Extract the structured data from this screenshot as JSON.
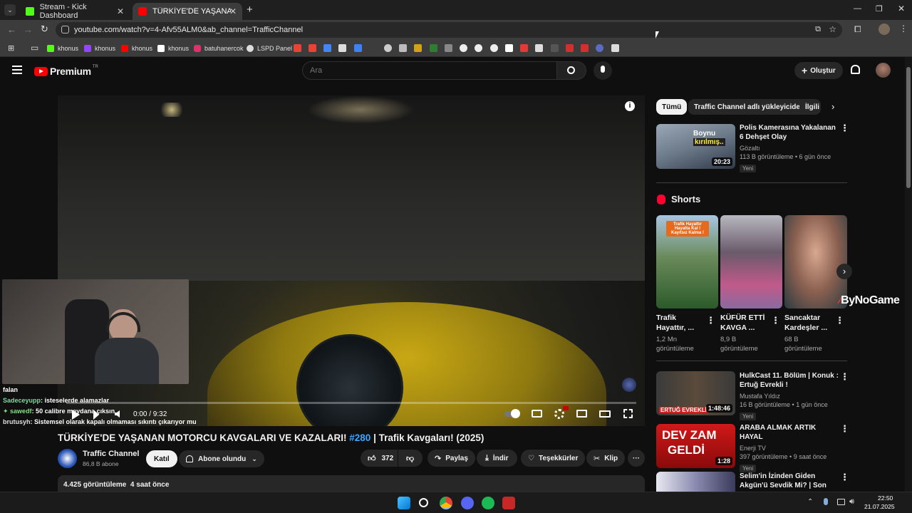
{
  "browser": {
    "tabs": [
      {
        "title": "Stream - Kick Dashboard",
        "color": "#53fc18"
      },
      {
        "title": "TÜRKİYE'DE YAŞANAN MOTORC",
        "color": "#ff0000"
      }
    ],
    "url": "youtube.com/watch?v=4-Afv55ALM0&ab_channel=TrafficChannel",
    "bookmarks": [
      {
        "label": "khonus",
        "color": "#53fc18"
      },
      {
        "label": "khonus",
        "color": "#9146ff"
      },
      {
        "label": "khonus",
        "color": "#ff0000"
      },
      {
        "label": "khonus",
        "color": "#ffffff"
      },
      {
        "label": "batuhanercok",
        "color": "#e1306c"
      },
      {
        "label": "LSPD Panel",
        "color": "#dddddd"
      }
    ]
  },
  "youtube": {
    "logo": "Premium",
    "logo_sup": "TR",
    "search_placeholder": "Ara",
    "create_label": "Oluştur",
    "video": {
      "title_pre": "TÜRKİYE'DE YAŞANAN MOTORCU KAVGALARI VE KAZALARI!",
      "hashtag": "#280",
      "title_post": "| Trafik Kavgaları! (2025)",
      "time": "0:00 / 9:32",
      "progress": 0,
      "views_line": "4.425 görüntüleme  4 saat önce"
    },
    "channel": {
      "name": "Traffic Channel",
      "subs": "86,8 B abone",
      "join": "Katıl",
      "subscribed": "Abone olundu"
    },
    "actions": {
      "likes": "372",
      "share": "Paylaş",
      "download": "İndir",
      "thanks": "Teşekkürler",
      "clip": "Klip"
    },
    "chips": [
      "Tümü",
      "Traffic Channel adlı yükleyiciden",
      "İlgili"
    ],
    "first_video": {
      "title": "Polis Kamerasına Yakalanan 6 Dehşet Olay",
      "channel": "Gözaltı",
      "meta": "113 B görüntüleme • 6 gün önce",
      "badge": "Yeni",
      "duration": "20:23",
      "overlay1": "Boynu",
      "overlay2": "kırılmış.."
    },
    "shorts_title": "Shorts",
    "shorts": [
      {
        "title": "Trafik Hayattır, ...",
        "views": "1,2 Mn görüntüleme",
        "overlay": "Trafik Hayattır Hayatta Kal ! Kayıtsız Kalma !"
      },
      {
        "title": "KÜFÜR ETTİ KAVGA ...",
        "views": "8,9 B görüntüleme"
      },
      {
        "title": "Sancaktar Kardeşler ...",
        "views": "68 B görüntüleme"
      }
    ],
    "watermark": "ByNoGame",
    "more_videos": [
      {
        "title": "HulkCast 11. Bölüm | Konuk : Ertuğ Evrekli !",
        "channel": "Mustafa Yıldız",
        "meta": "16 B görüntüleme • 1 gün önce",
        "badge": "Yeni",
        "duration": "1:48:46",
        "thumb_text": "ERTUĞ EVREKLİ"
      },
      {
        "title": "ARABA ALMAK ARTIK HAYAL",
        "channel": "Enerji TV",
        "meta": "397 görüntüleme • 9 saat önce",
        "badge": "Yeni",
        "duration": "1:28",
        "thumb_text1": "DEV ZAM",
        "thumb_text2": "GELDİ"
      },
      {
        "title": "Selim'in İzinden Giden Akgün'ü Sevdik Mi? | Son Yaz",
        "channel": "",
        "meta": "",
        "badge": "",
        "duration": ""
      }
    ]
  },
  "stream_chat": [
    {
      "user": "",
      "text": "falan",
      "user_color": "#ffffff"
    },
    {
      "user": "Sadeceyupp",
      "text": ": isteselerde alamazlar",
      "user_color": "#7fd6a0"
    },
    {
      "user": "sawedf",
      "text": ": 50 calibre meydana çıksın",
      "user_color": "#7fe07f"
    },
    {
      "user": "brutusyh",
      "text": ": Sistemsel olarak kapalı olmaması sıkıntı çıkarıyor mu",
      "user_color": "#e0e0e0"
    }
  ],
  "taskbar": {
    "time": "22:50",
    "date": "21.07.2025"
  }
}
